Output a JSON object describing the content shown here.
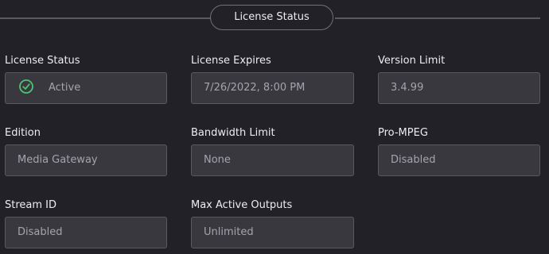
{
  "section": {
    "title": "License Status"
  },
  "fields": {
    "license_status": {
      "label": "License Status",
      "value": "Active",
      "icon": "check-circle-icon",
      "icon_color": "#4cc470"
    },
    "license_expires": {
      "label": "License Expires",
      "value": "7/26/2022, 8:00 PM"
    },
    "version_limit": {
      "label": "Version Limit",
      "value": "3.4.99"
    },
    "edition": {
      "label": "Edition",
      "value": "Media Gateway"
    },
    "bandwidth_limit": {
      "label": "Bandwidth Limit",
      "value": "None"
    },
    "pro_mpeg": {
      "label": "Pro-MPEG",
      "value": "Disabled"
    },
    "stream_id": {
      "label": "Stream ID",
      "value": "Disabled"
    },
    "max_active_outputs": {
      "label": "Max Active Outputs",
      "value": "Unlimited"
    }
  },
  "colors": {
    "background": "#222127",
    "field_background": "#39383f",
    "field_border": "#5a5960",
    "label_text": "#ededf0",
    "value_text": "#a5a4ab"
  }
}
